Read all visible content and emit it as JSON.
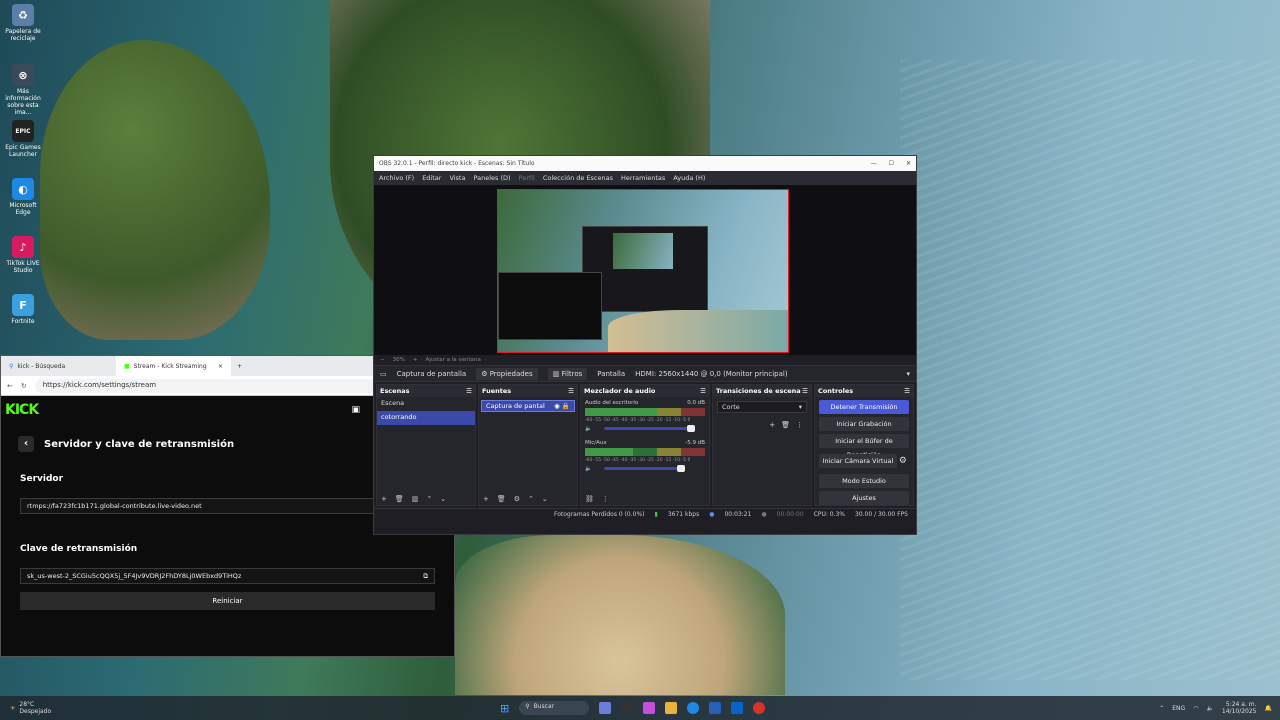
{
  "desktop": {
    "icons": [
      {
        "label": "Papelera de reciclaje",
        "icon": "recycle-bin-icon",
        "glyph": "♻",
        "color": "#5a7fa8"
      },
      {
        "label": "Más información sobre esta ima...",
        "icon": "info-icon",
        "glyph": "⊗",
        "color": "#3a4a5a"
      },
      {
        "label": "Epic Games Launcher",
        "icon": "epic-games-icon",
        "glyph": "EPIC",
        "color": "#222"
      },
      {
        "label": "Microsoft Edge",
        "icon": "edge-icon",
        "glyph": "◐",
        "color": "#1e88e5"
      },
      {
        "label": "TikTok LIVE Studio",
        "icon": "tiktok-icon",
        "glyph": "♪",
        "color": "#d81b60"
      },
      {
        "label": "Fortnite",
        "icon": "fortnite-icon",
        "glyph": "F",
        "color": "#3aa0e0"
      }
    ]
  },
  "browser": {
    "tabs": [
      {
        "label": "kick - Búsqueda"
      },
      {
        "label": "Stream - Kick Streaming"
      }
    ],
    "url": "https://kick.com/settings/stream",
    "logo": "KICK",
    "page_title": "Servidor y clave de retransmisión",
    "server_label": "Servidor",
    "server_value": "rtmps://fa723fc1b171.global-contribute.live-video.net",
    "key_label": "Clave de retransmisión",
    "key_value": "sk_us-west-2_SCGiu5cQQX5j_5F4Jv9VDRJ2FhDY8Lj0WEbxd9TiHQz",
    "reset_button": "Reiniciar"
  },
  "obs": {
    "title": "OBS 32.0.1 - Perfil: directo kick - Escenas: Sin Título",
    "menu": [
      "Archivo (F)",
      "Editar",
      "Vista",
      "Paneles (D)",
      "Perfil",
      "Colección de Escenas",
      "Herramientas",
      "Ayuda (H)"
    ],
    "zoom": "30%",
    "fit_label": "Ajustar a la ventana",
    "source_bar": {
      "source_name": "Captura de pantalla",
      "properties": "Propiedades",
      "filters": "Filtros",
      "screen_label": "Pantalla",
      "screen_value": "HDMI: 2560x1440 @ 0,0 (Monitor principal)"
    },
    "scenes": {
      "header": "Escenas",
      "items": [
        "Escena",
        "cotorrando"
      ],
      "selected": 1
    },
    "sources": {
      "header": "Fuentes",
      "items": [
        "Captura de pantal"
      ]
    },
    "mixer": {
      "header": "Mezclador de audio",
      "channels": [
        {
          "name": "Audio del escritorio",
          "db": "0.0 dB",
          "level": 0.6
        },
        {
          "name": "Mic/Aux",
          "db": "-5.9 dB",
          "level": 0.4
        }
      ],
      "scale": "-60 -55 -50 -45 -40 -35 -30 -25 -20 -15 -10 -5 0"
    },
    "transitions": {
      "header": "Transiciones de escena",
      "value": "Corte"
    },
    "controls": {
      "header": "Controles",
      "buttons": [
        "Detener Transmisión",
        "Iniciar Grabación",
        "Iniciar el Búfer de Repetición",
        "Iniciar Cámara Virtual",
        "Modo Estudio",
        "Ajustes"
      ]
    },
    "status": {
      "dropped": "Fotogramas Perdidos 0 (0.0%)",
      "bitrate": "3671 kbps",
      "stream_time": "00:03:21",
      "rec_time": "00:00:00",
      "cpu": "CPU: 0.3%",
      "fps": "30.00 / 30.00 FPS"
    }
  },
  "taskbar": {
    "weather_temp": "28°C",
    "weather_desc": "Despejado",
    "search": "Buscar",
    "lang": "ENG",
    "time": "5:24 a. m.",
    "date": "14/10/2025"
  }
}
